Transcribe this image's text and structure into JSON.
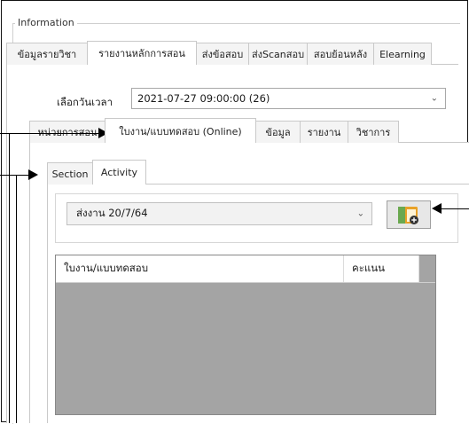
{
  "group": {
    "title": "Information"
  },
  "main_tabs": [
    {
      "label": "ข้อมูลรายวิชา",
      "active": false
    },
    {
      "label": "รายงานหลักการสอน",
      "active": true
    },
    {
      "label": "ส่งข้อสอบ",
      "active": false
    },
    {
      "label": "ส่งScanสอบ",
      "active": false
    },
    {
      "label": "สอบย้อนหลัง",
      "active": false
    },
    {
      "label": "Elearning",
      "active": false
    }
  ],
  "date_selector": {
    "label": "เลือกวันเวลา",
    "value": "2021-07-27 09:00:00 (26)"
  },
  "sub_tabs": [
    {
      "label": "หน่วยการสอน",
      "active": false
    },
    {
      "label": "ใบงาน/แบบทดสอบ (Online)",
      "active": true
    },
    {
      "label": "ข้อมูล",
      "active": false
    },
    {
      "label": "รายงาน",
      "active": false
    },
    {
      "label": "วิชาการ",
      "active": false
    }
  ],
  "inner_tabs": [
    {
      "label": "Section",
      "active": false
    },
    {
      "label": "Activity",
      "active": true
    }
  ],
  "activity_select": {
    "value": "ส่งงาน 20/7/64"
  },
  "grid": {
    "columns": [
      "ใบงาน/แบบทดสอบ",
      "คะแนน",
      ""
    ],
    "rows": []
  },
  "colors": {
    "folder": "#e9a227",
    "folder_green": "#6aa84f",
    "grid_bg": "#a4a4a4",
    "tab_border": "#c9c9c9"
  }
}
